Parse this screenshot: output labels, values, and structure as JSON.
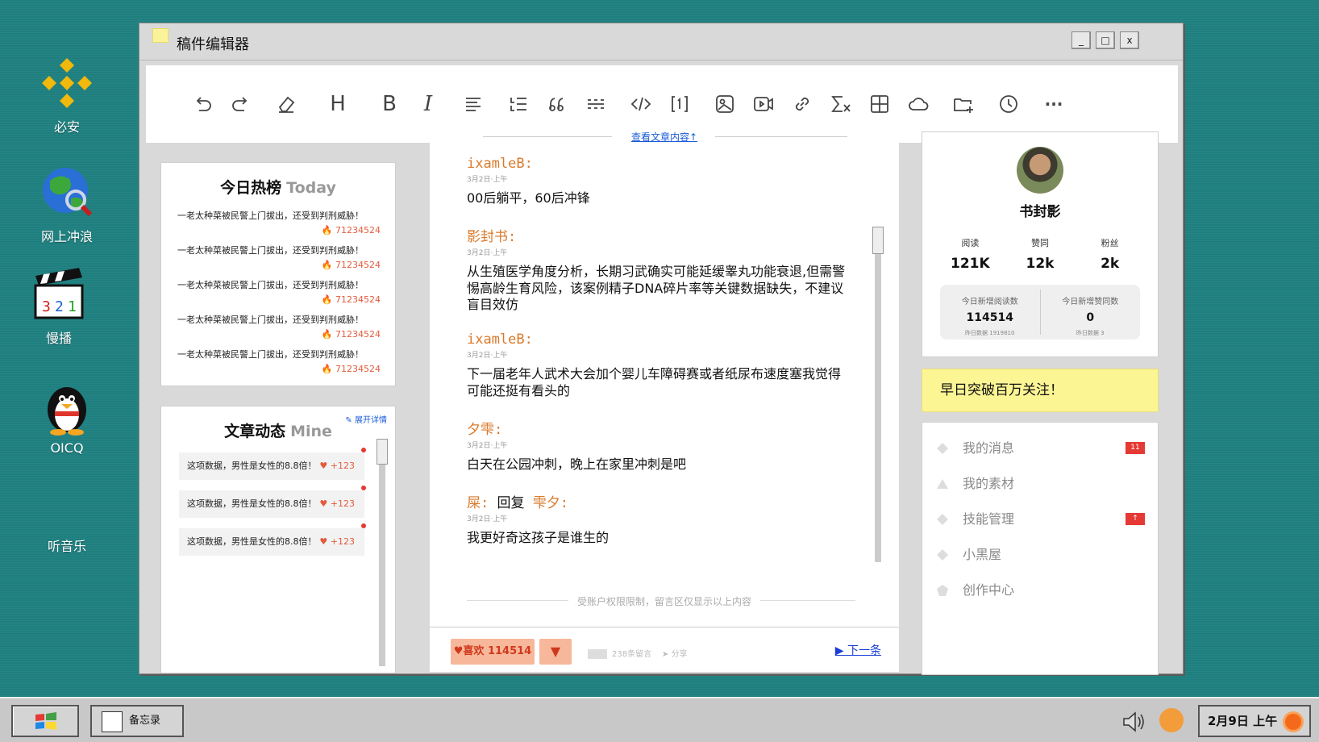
{
  "desktop": {
    "icons": [
      {
        "label": "必安"
      },
      {
        "label": "网上冲浪"
      },
      {
        "label": "慢播"
      },
      {
        "label": "OICQ"
      },
      {
        "label": "听音乐"
      }
    ]
  },
  "window": {
    "title": "稿件编辑器",
    "controls": {
      "minimize": "_",
      "maximize": "□",
      "close": "x"
    }
  },
  "toolbar": {
    "heading": "H",
    "bold": "B",
    "italic": "I",
    "more": "···"
  },
  "hot": {
    "title": "今日热榜",
    "title_en": "Today",
    "items": [
      {
        "text": "一老太种菜被民警上门拔出，还受到判刑威胁！",
        "count": "71234524"
      },
      {
        "text": "一老太种菜被民警上门拔出，还受到判刑威胁！",
        "count": "71234524"
      },
      {
        "text": "一老太种菜被民警上门拔出，还受到判刑威胁！",
        "count": "71234524"
      },
      {
        "text": "一老太种菜被民警上门拔出，还受到判刑威胁！",
        "count": "71234524"
      },
      {
        "text": "一老太种菜被民警上门拔出，还受到判刑威胁！",
        "count": "71234524"
      }
    ]
  },
  "mine": {
    "title": "文章动态",
    "title_en": "Mine",
    "expand": "展开详情",
    "items": [
      {
        "text": "这项数据，男性是女性的8.8倍！",
        "likes": "+123"
      },
      {
        "text": "这项数据，男性是女性的8.8倍！",
        "likes": "+123"
      },
      {
        "text": "这项数据，男性是女性的8.8倍！",
        "likes": "+123"
      }
    ]
  },
  "comments": {
    "top_link": "查看文章内容↑",
    "list": [
      {
        "author": "ixamleB:",
        "date": "3月2日·上午",
        "body": "00后躺平，60后冲锋"
      },
      {
        "author": "影封书:",
        "date": "3月2日·上午",
        "body": "从生殖医学角度分析，长期习武确实可能延缓睾丸功能衰退,但需警惕高龄生育风险，该案例精子DNA碎片率等关键数据缺失，不建议盲目效仿"
      },
      {
        "author": "ixamleB:",
        "date": "3月2日·上午",
        "body": "下一届老年人武术大会加个婴儿车障碍赛或者纸尿布速度塞我觉得可能还挺有看头的"
      },
      {
        "author": "夕雫:",
        "date": "3月2日·上午",
        "body": "白天在公园冲刺，晚上在家里冲刺是吧"
      },
      {
        "author": "屎:",
        "reply_word": "回复",
        "reply_to": "雫夕:",
        "date": "3月2日·上午",
        "body": "我更好奇这孩子是谁生的"
      }
    ],
    "limit_note": "受账户权限限制，留言区仅显示以上内容"
  },
  "actions": {
    "like_label": "♥喜欢 114514",
    "down_label": "▼",
    "comments_count": "238条留言",
    "share_label": "分享",
    "next_label": "▶ 下一条"
  },
  "profile": {
    "name": "书封影",
    "stats": [
      {
        "label": "阅读",
        "value": "121K"
      },
      {
        "label": "赞同",
        "value": "12k"
      },
      {
        "label": "粉丝",
        "value": "2k"
      }
    ],
    "today": [
      {
        "label": "今日新增阅读数",
        "value": "114514",
        "sub": "昨日数据 1919810"
      },
      {
        "label": "今日新增赞同数",
        "value": "0",
        "sub": "昨日数据 3"
      }
    ]
  },
  "banner": "早日突破百万关注！",
  "menu": [
    {
      "label": "我的消息",
      "badge": "11"
    },
    {
      "label": "我的素材",
      "badge": ""
    },
    {
      "label": "技能管理",
      "badge": "↑"
    },
    {
      "label": "小黑屋",
      "badge": ""
    },
    {
      "label": "创作中心",
      "badge": ""
    }
  ],
  "taskbar": {
    "task_label": "备忘录",
    "clock": "2月9日 上午"
  }
}
